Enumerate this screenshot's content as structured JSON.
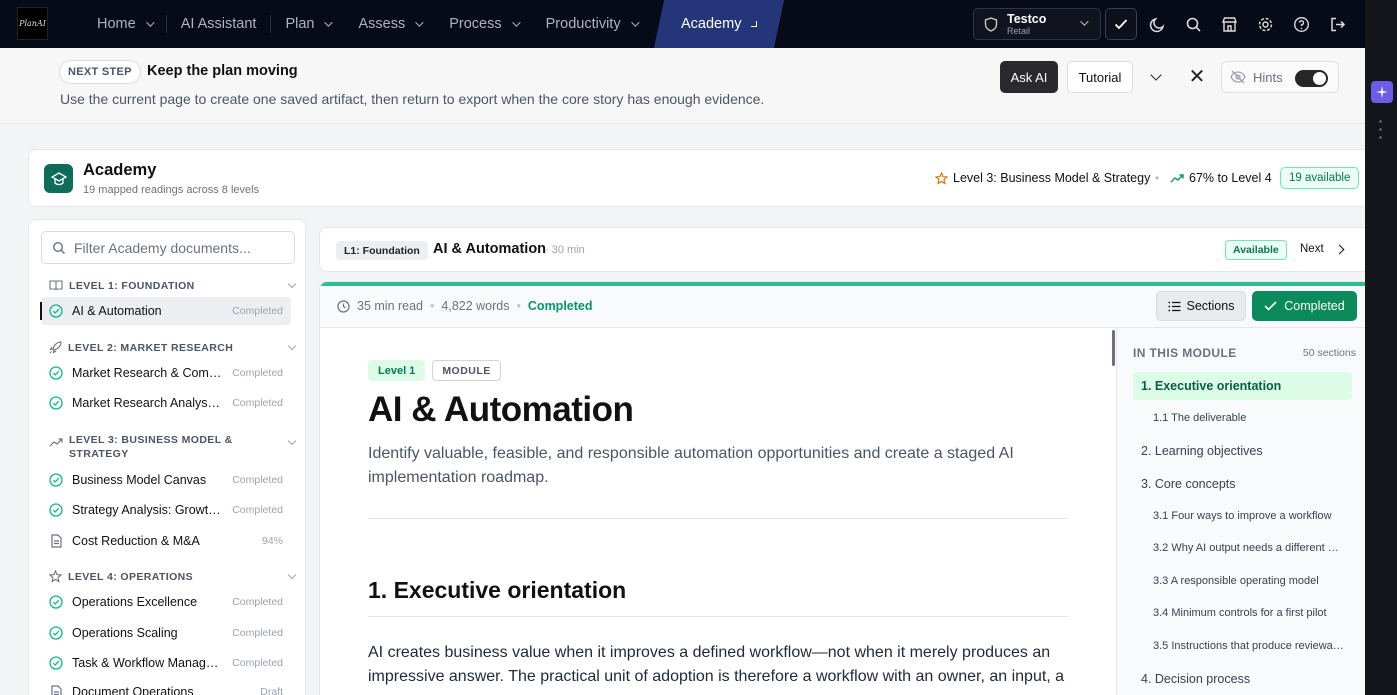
{
  "brand": {
    "logo_text": "PlanAI"
  },
  "nav": {
    "items": [
      {
        "label": "Home",
        "dropdown": true
      },
      {
        "label": "AI Assistant",
        "dropdown": false
      },
      {
        "label": "Plan",
        "dropdown": true
      },
      {
        "label": "Assess",
        "dropdown": true
      },
      {
        "label": "Process",
        "dropdown": true
      },
      {
        "label": "Productivity",
        "dropdown": true
      },
      {
        "label": "Academy",
        "dropdown": true,
        "active": true
      }
    ],
    "org": {
      "name": "Testco",
      "type": "Retail"
    },
    "icons": [
      "check-icon",
      "moon-icon",
      "search-icon",
      "store-icon",
      "gear-icon",
      "help-icon",
      "logout-icon"
    ]
  },
  "hint": {
    "badge": "NEXT STEP",
    "title": "Keep the plan moving",
    "description": "Use the current page to create one saved artifact, then return to export when the core story has enough evidence.",
    "ask_ai": "Ask AI",
    "tutorial": "Tutorial",
    "hints_label": "Hints"
  },
  "academy": {
    "title": "Academy",
    "subtitle": "19 mapped readings across 8 levels",
    "level": "Level 3: Business Model & Strategy",
    "progress": "67% to Level 4",
    "available": "19 available"
  },
  "sidebar": {
    "filter_placeholder": "Filter Academy documents...",
    "levels": [
      {
        "label": "LEVEL 1: FOUNDATION",
        "icon": "book-icon",
        "docs": [
          {
            "name": "AI & Automation",
            "status": "Completed",
            "selected": true
          }
        ]
      },
      {
        "label": "LEVEL 2: MARKET RESEARCH",
        "icon": "rocket-icon",
        "docs": [
          {
            "name": "Market Research & Comp…",
            "status": "Completed"
          },
          {
            "name": "Market Research Analysis …",
            "status": "Completed"
          }
        ]
      },
      {
        "label": "LEVEL 3: BUSINESS MODEL & STRATEGY",
        "icon": "trending-icon",
        "docs": [
          {
            "name": "Business Model Canvas",
            "status": "Completed"
          },
          {
            "name": "Strategy Analysis: Growth …",
            "status": "Completed"
          },
          {
            "name": "Cost Reduction & M&A",
            "status": "94%"
          }
        ]
      },
      {
        "label": "LEVEL 4: OPERATIONS",
        "icon": "star-icon",
        "docs": [
          {
            "name": "Operations Excellence",
            "status": "Completed"
          },
          {
            "name": "Operations Scaling",
            "status": "Completed"
          },
          {
            "name": "Task & Workflow Manage…",
            "status": "Completed"
          },
          {
            "name": "Document Operations",
            "status": "Draft"
          }
        ]
      }
    ]
  },
  "docbar": {
    "level_badge": "L1: Foundation",
    "title": "AI & Automation",
    "duration": "· 30 min",
    "status": "Available",
    "next": "Next"
  },
  "reader": {
    "read_time": "35 min read",
    "words": "4,822 words",
    "state": "Completed",
    "sections_btn": "Sections",
    "completed_btn": "Completed"
  },
  "article": {
    "tag_level": "Level 1",
    "tag_type": "MODULE",
    "title": "AI & Automation",
    "lead": "Identify valuable, feasible, and responsible automation opportunities and create a staged AI implementation roadmap.",
    "h2": "1. Executive orientation",
    "paragraph": "AI creates business value when it improves a defined workflow—not when it merely produces an impressive answer. The practical unit of adoption is therefore a workflow with an owner, an input, a"
  },
  "toc": {
    "heading": "IN THIS MODULE",
    "count": "50 sections",
    "items": [
      {
        "label": "1. Executive orientation",
        "sub": false,
        "active": true
      },
      {
        "label": "1.1 The deliverable",
        "sub": true
      },
      {
        "label": "2. Learning objectives",
        "sub": false
      },
      {
        "label": "3. Core concepts",
        "sub": false
      },
      {
        "label": "3.1 Four ways to improve a workflow",
        "sub": true
      },
      {
        "label": "3.2 Why AI output needs a different …",
        "sub": true
      },
      {
        "label": "3.3 A responsible operating model",
        "sub": true
      },
      {
        "label": "3.4 Minimum controls for a first pilot",
        "sub": true
      },
      {
        "label": "3.5 Instructions that produce reviewa…",
        "sub": true
      },
      {
        "label": "4. Decision process",
        "sub": false
      }
    ]
  }
}
